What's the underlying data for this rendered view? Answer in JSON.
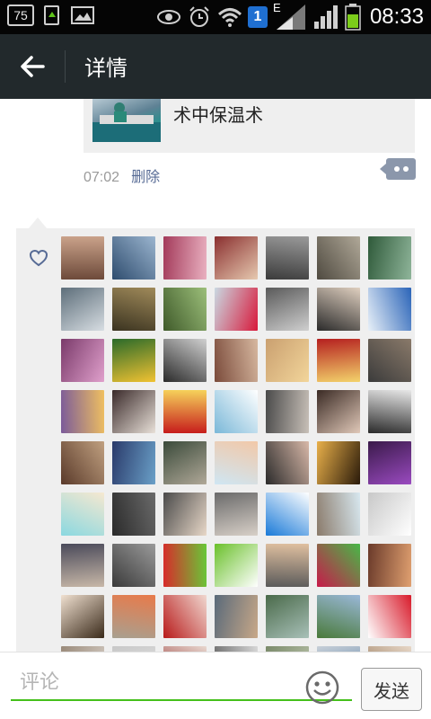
{
  "status_bar": {
    "notification_count": "75",
    "sim_badge": "1",
    "network_type": "E",
    "time": "08:33",
    "icons": [
      "notification-count-icon",
      "refresh-icon",
      "gallery-icon",
      "eye-icon",
      "alarm-icon",
      "wifi-icon",
      "sim-icon",
      "signal-icon",
      "battery-icon"
    ]
  },
  "header": {
    "back_icon": "arrow-left-icon",
    "title": "详情"
  },
  "post": {
    "share_text": "术中保温术",
    "time": "07:02",
    "delete_label": "删除",
    "comment_icon": "comment-bubble-icon"
  },
  "likes": {
    "icon": "heart-icon",
    "avatars": [
      {
        "name": "avatar-1"
      },
      {
        "name": "avatar-2"
      },
      {
        "name": "avatar-3"
      },
      {
        "name": "avatar-4"
      },
      {
        "name": "avatar-5"
      },
      {
        "name": "avatar-6"
      },
      {
        "name": "avatar-7"
      },
      {
        "name": "avatar-8"
      },
      {
        "name": "avatar-9"
      },
      {
        "name": "avatar-10"
      },
      {
        "name": "avatar-11"
      },
      {
        "name": "avatar-12"
      },
      {
        "name": "avatar-13"
      },
      {
        "name": "avatar-14"
      },
      {
        "name": "avatar-15"
      },
      {
        "name": "avatar-16"
      },
      {
        "name": "avatar-17"
      },
      {
        "name": "avatar-18"
      },
      {
        "name": "avatar-19"
      },
      {
        "name": "avatar-20"
      },
      {
        "name": "avatar-21"
      },
      {
        "name": "avatar-22"
      },
      {
        "name": "avatar-23"
      },
      {
        "name": "avatar-24"
      },
      {
        "name": "avatar-25"
      },
      {
        "name": "avatar-26"
      },
      {
        "name": "avatar-27"
      },
      {
        "name": "avatar-28"
      },
      {
        "name": "avatar-29"
      },
      {
        "name": "avatar-30"
      },
      {
        "name": "avatar-31"
      },
      {
        "name": "avatar-32"
      },
      {
        "name": "avatar-33"
      },
      {
        "name": "avatar-34"
      },
      {
        "name": "avatar-35"
      },
      {
        "name": "avatar-36"
      },
      {
        "name": "avatar-37"
      },
      {
        "name": "avatar-38"
      },
      {
        "name": "avatar-39"
      },
      {
        "name": "avatar-40"
      },
      {
        "name": "avatar-41"
      },
      {
        "name": "avatar-42"
      },
      {
        "name": "avatar-43"
      },
      {
        "name": "avatar-44"
      },
      {
        "name": "avatar-45"
      },
      {
        "name": "avatar-46"
      },
      {
        "name": "avatar-47"
      },
      {
        "name": "avatar-48"
      },
      {
        "name": "avatar-49"
      },
      {
        "name": "avatar-50"
      },
      {
        "name": "avatar-51"
      },
      {
        "name": "avatar-52"
      },
      {
        "name": "avatar-53"
      },
      {
        "name": "avatar-54"
      },
      {
        "name": "avatar-55"
      },
      {
        "name": "avatar-56"
      },
      {
        "name": "avatar-57"
      },
      {
        "name": "avatar-58"
      },
      {
        "name": "avatar-59"
      },
      {
        "name": "avatar-60"
      },
      {
        "name": "avatar-61"
      },
      {
        "name": "avatar-62"
      },
      {
        "name": "avatar-63"
      }
    ]
  },
  "comment_bar": {
    "placeholder": "评论",
    "emoji_icon": "emoji-smile-icon",
    "send_label": "发送"
  },
  "colors": {
    "status_bar_bg": "#050505",
    "title_bar_bg": "#22292c",
    "link_blue": "#576b95",
    "input_underline": "#45c01a",
    "battery_green": "#7ccd1a",
    "sim_blue": "#1f6fd1"
  }
}
